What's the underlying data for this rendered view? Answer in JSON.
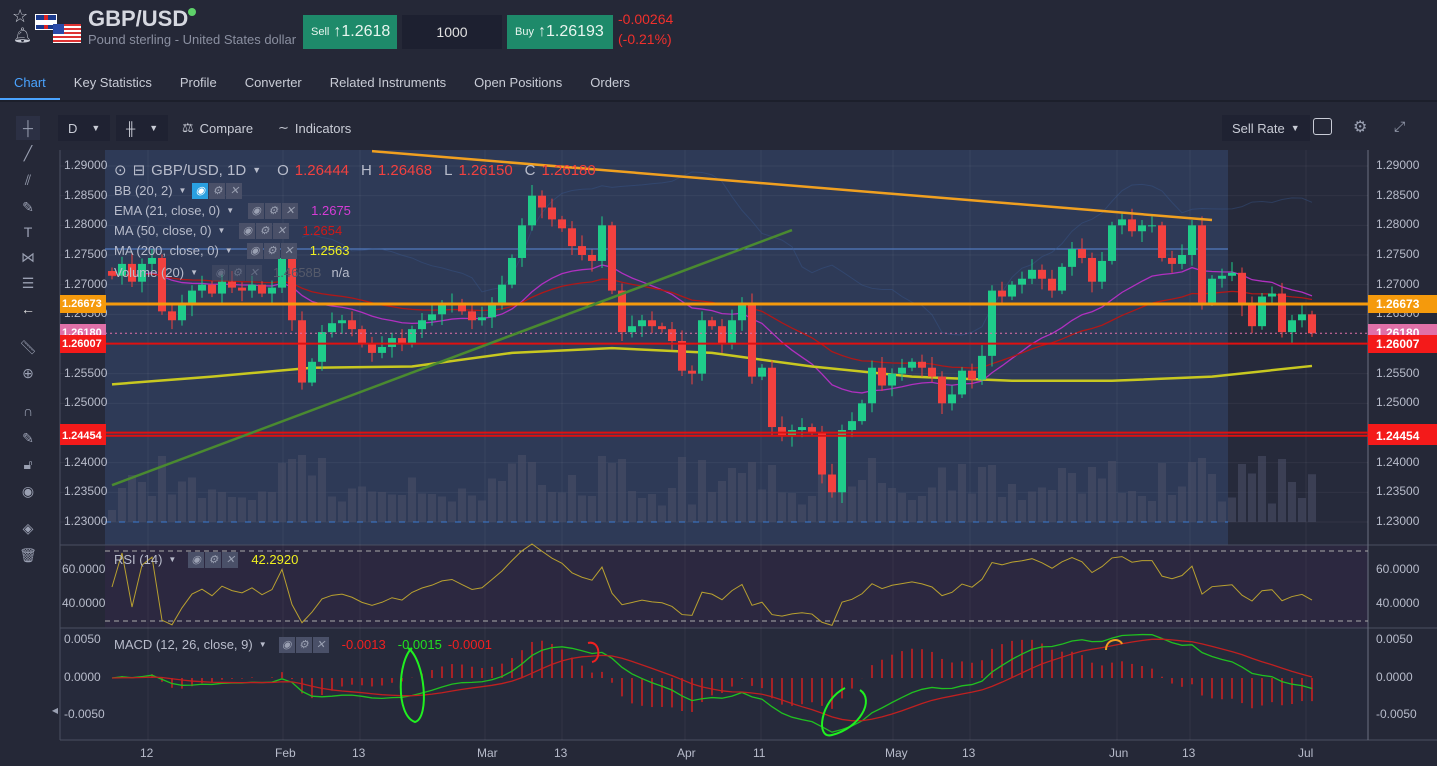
{
  "header": {
    "title": "GBP/USD",
    "subtitle": "Pound sterling - United States dollar",
    "sell_label": "Sell",
    "sell_price": "1.2618",
    "quantity": "1000",
    "buy_label": "Buy",
    "buy_price": "1.26193",
    "change": "-0.00264",
    "change_pct": "(-0.21%)"
  },
  "tabs": [
    {
      "label": "Chart"
    },
    {
      "label": "Key Statistics"
    },
    {
      "label": "Profile"
    },
    {
      "label": "Converter"
    },
    {
      "label": "Related Instruments"
    },
    {
      "label": "Open Positions"
    },
    {
      "label": "Orders"
    }
  ],
  "toolbar": {
    "interval": "D",
    "compare": "Compare",
    "indicators": "Indicators",
    "rate_select": "Sell Rate"
  },
  "legend": {
    "symbol": "GBP/USD, 1D",
    "o_label": "O",
    "o": "1.26444",
    "h_label": "H",
    "h": "1.26468",
    "l_label": "L",
    "l": "1.26150",
    "c_label": "C",
    "c": "1.26180",
    "bb": "BB (20, 2)",
    "ema": "EMA (21, close, 0)",
    "ema_val": "1.2675",
    "ma50": "MA (50, close, 0)",
    "ma50_val": "1.2654",
    "ma200": "MA (200, close, 0)",
    "ma200_val": "1.2563",
    "volume": "Volume (20)",
    "volume_val": "1.4658B",
    "volume_ma": "n/a",
    "rsi": "RSI (14)",
    "rsi_val": "42.2920",
    "macd": "MACD (12, 26, close, 9)",
    "macd_val1": "-0.0013",
    "macd_val2": "-0.0015",
    "macd_val3": "-0.0001"
  },
  "price_axis": [
    "1.29000",
    "1.28500",
    "1.28000",
    "1.27500",
    "1.27000",
    "1.26500",
    "1.25500",
    "1.25000",
    "1.24000",
    "1.23500",
    "1.23000"
  ],
  "price_labels": [
    {
      "value": "1.26673",
      "color": "#f59a0c"
    },
    {
      "value": "1.26180",
      "color": "#e070a8"
    },
    {
      "value": "1.26007",
      "color": "#f41a1a"
    },
    {
      "value": "1.24507",
      "color": "#f41a1a"
    },
    {
      "value": "1.24454",
      "color": "#f41a1a"
    }
  ],
  "rsi_axis": [
    "60.0000",
    "40.0000"
  ],
  "macd_axis": [
    "0.0050",
    "0.0000",
    "-0.0050"
  ],
  "x_axis": [
    "12",
    "Feb",
    "13",
    "Mar",
    "13",
    "Apr",
    "11",
    "May",
    "13",
    "Jun",
    "13",
    "Jul"
  ],
  "chart_data": {
    "type": "candlestick",
    "ylim": [
      1.228,
      1.292
    ],
    "close": [
      1.2715,
      1.2735,
      1.2705,
      1.2735,
      1.2745,
      1.2655,
      1.264,
      1.2665,
      1.269,
      1.27,
      1.2685,
      1.2705,
      1.2695,
      1.269,
      1.27,
      1.2685,
      1.2695,
      1.2745,
      1.264,
      1.2535,
      1.257,
      1.262,
      1.2635,
      1.264,
      1.2625,
      1.26,
      1.2585,
      1.2595,
      1.261,
      1.26,
      1.2625,
      1.264,
      1.265,
      1.2665,
      1.267,
      1.2655,
      1.264,
      1.2645,
      1.267,
      1.27,
      1.2745,
      1.28,
      1.285,
      1.283,
      1.281,
      1.2795,
      1.2765,
      1.275,
      1.274,
      1.28,
      1.269,
      1.262,
      1.263,
      1.264,
      1.263,
      1.2625,
      1.2605,
      1.2555,
      1.255,
      1.264,
      1.263,
      1.26,
      1.264,
      1.267,
      1.2545,
      1.256,
      1.246,
      1.2445,
      1.2455,
      1.246,
      1.245,
      1.238,
      1.235,
      1.2455,
      1.247,
      1.25,
      1.256,
      1.253,
      1.255,
      1.256,
      1.257,
      1.256,
      1.2545,
      1.25,
      1.2515,
      1.2555,
      1.254,
      1.258,
      1.269,
      1.268,
      1.27,
      1.271,
      1.2725,
      1.271,
      1.269,
      1.273,
      1.276,
      1.2745,
      1.2705,
      1.274,
      1.28,
      1.281,
      1.279,
      1.28,
      1.28,
      1.2745,
      1.2735,
      1.275,
      1.28,
      1.267,
      1.271,
      1.2715,
      1.272,
      1.2665,
      1.263,
      1.268,
      1.2685,
      1.262,
      1.264,
      1.265,
      1.2618
    ],
    "ma200": [
      1.2532,
      1.2545,
      1.256,
      1.2562,
      1.2585,
      1.2593,
      1.2585,
      1.2562,
      1.2545,
      1.2538,
      1.2538,
      1.2545,
      1.2563
    ],
    "hlines": [
      1.26673,
      1.26007,
      1.24507,
      1.24454
    ],
    "trend_orange": [
      [
        26,
        1.2925
      ],
      [
        110,
        1.2809
      ]
    ],
    "trend_green": [
      [
        0,
        1.2362
      ],
      [
        68,
        1.2792
      ]
    ]
  }
}
